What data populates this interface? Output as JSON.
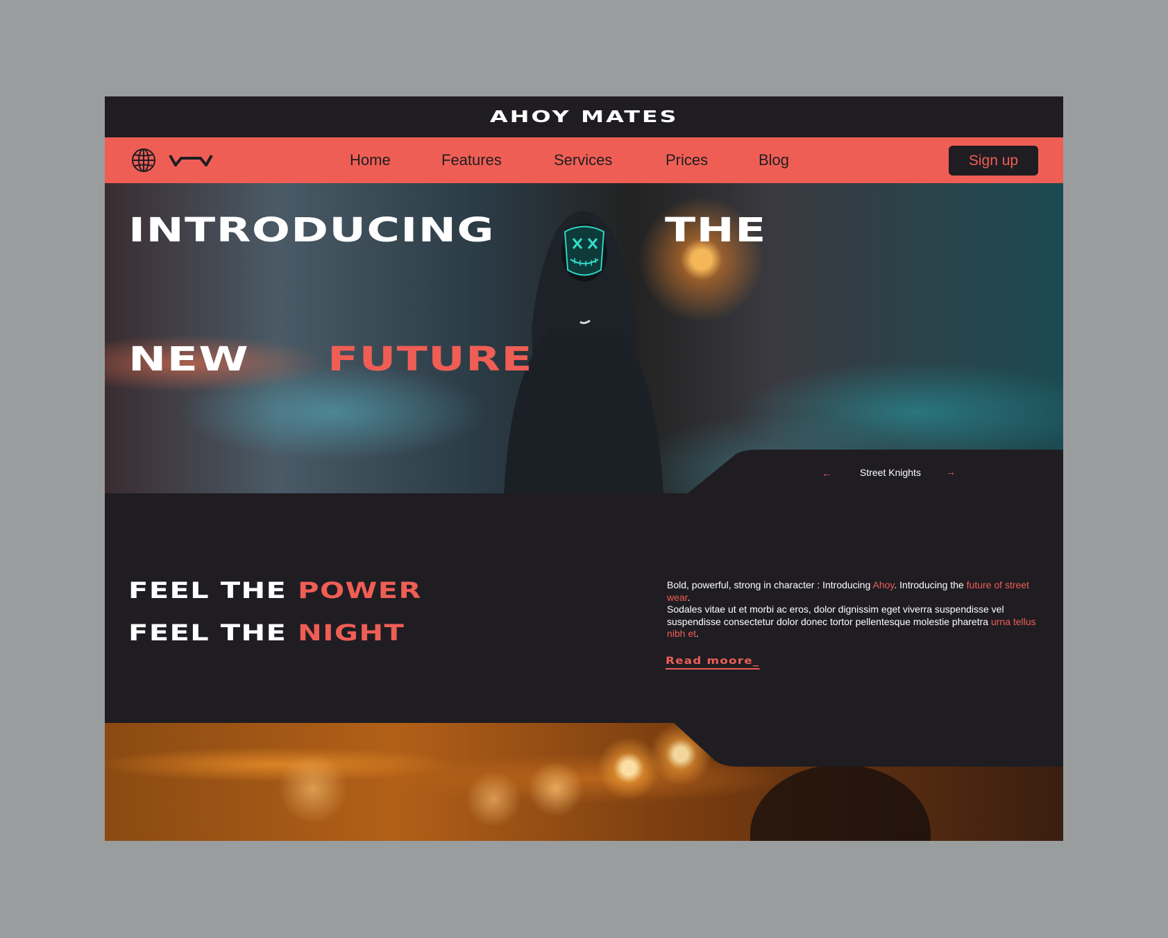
{
  "brand": {
    "title": "AHOY MATES"
  },
  "nav": {
    "items": [
      {
        "label": "Home"
      },
      {
        "label": "Features"
      },
      {
        "label": "Services"
      },
      {
        "label": "Prices"
      },
      {
        "label": "Blog"
      }
    ],
    "signup_label": "Sign up"
  },
  "hero": {
    "line1_a": "INTRODUCING",
    "line1_b": "THE",
    "line2_a": "NEW",
    "line2_b": "FUTURE",
    "caption": "Street Knights",
    "prev_arrow": "←",
    "next_arrow": "→"
  },
  "middle": {
    "slogan1_a": "FEEL THE",
    "slogan1_b": "POWER",
    "slogan2_a": "FEEL THE",
    "slogan2_b": "NIGHT",
    "para_1": "Bold, powerful, strong in character : Introducing ",
    "para_ahoy": "Ahoy",
    "para_2": ". Introducing the ",
    "para_future": "future of street wear",
    "para_3": ".",
    "para_4": "Sodales vitae ut et morbi ac eros, dolor dignissim eget viverra suspendisse vel suspendisse consectetur dolor donec tortor pellentesque molestie pharetra ",
    "para_urna": "urna tellus nibh et",
    "para_5": ".",
    "read_more": "Read moore_"
  },
  "colors": {
    "accent": "#ef5e55",
    "dark": "#1f1d22",
    "backdrop": "#9a9d9d"
  }
}
